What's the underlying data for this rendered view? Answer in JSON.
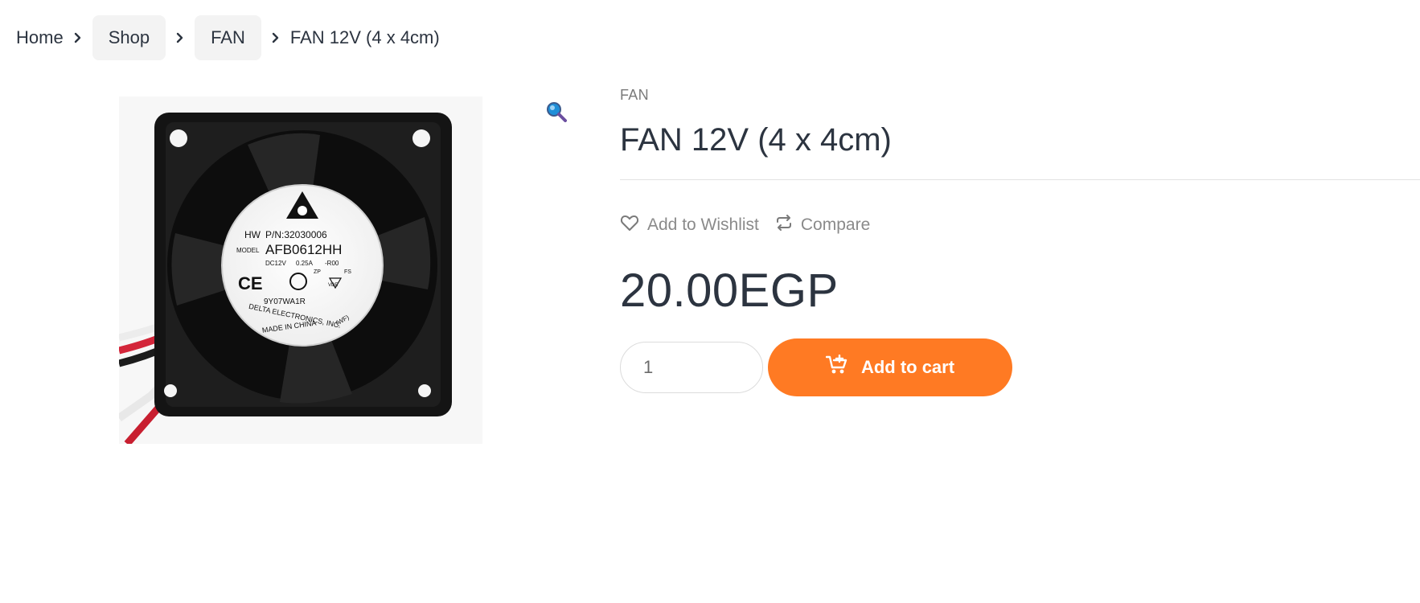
{
  "breadcrumb": {
    "home": "Home",
    "shop": "Shop",
    "category": "FAN",
    "current": "FAN 12V (4 x 4cm)"
  },
  "product": {
    "category": "FAN",
    "title": "FAN 12V (4 x 4cm)",
    "price": "20.00EGP",
    "image": {
      "label_hw": "HW",
      "label_pn": "P/N:32030006",
      "label_model": "MODEL",
      "model": "AFB0612HH",
      "spec_voltage": "DC12V",
      "spec_current": "0.25A",
      "spec_rev": "-R00",
      "serial": "9Y07WA1R",
      "maker": "DELTA ELECTRONICS, INC.",
      "made_in": "MADE IN CHINA",
      "wf": "(WF)",
      "cert_ce": "CE",
      "cert_zp": "ZP",
      "cert_fs": "FS",
      "cert_vde": "VDE"
    }
  },
  "actions": {
    "wishlist": "Add to Wishlist",
    "compare": "Compare"
  },
  "cart": {
    "quantity": "1",
    "button_label": "Add to cart"
  },
  "icons": {
    "chevron": "chevron-right-icon",
    "zoom": "magnifier-icon",
    "wishlist": "heart-icon",
    "compare": "compare-arrows-icon",
    "cart": "cart-plus-icon"
  },
  "colors": {
    "accent": "#ff7a23",
    "text": "#2c3440",
    "muted": "#8a8a8a",
    "pill": "#f3f3f3"
  }
}
